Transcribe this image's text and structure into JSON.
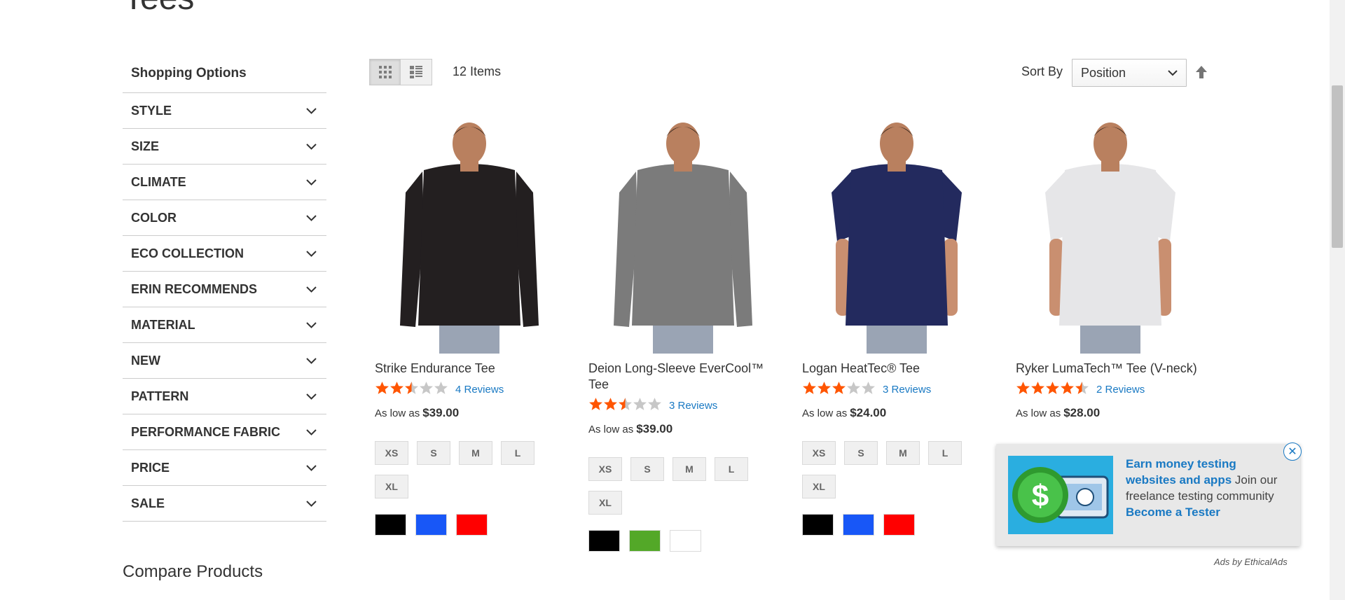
{
  "page": {
    "title": "Tees"
  },
  "sidebar": {
    "title": "Shopping Options",
    "filters": [
      {
        "label": "STYLE"
      },
      {
        "label": "SIZE"
      },
      {
        "label": "CLIMATE"
      },
      {
        "label": "COLOR"
      },
      {
        "label": "ECO COLLECTION"
      },
      {
        "label": "ERIN RECOMMENDS"
      },
      {
        "label": "MATERIAL"
      },
      {
        "label": "NEW"
      },
      {
        "label": "PATTERN"
      },
      {
        "label": "PERFORMANCE FABRIC"
      },
      {
        "label": "PRICE"
      },
      {
        "label": "SALE"
      }
    ],
    "compare_title": "Compare Products"
  },
  "toolbar": {
    "view_modes": [
      {
        "icon": "grid-icon",
        "active": true
      },
      {
        "icon": "list-icon",
        "active": false
      }
    ],
    "items_count": "12 Items",
    "sort_label": "Sort By",
    "sort_value": "Position",
    "sort_direction_icon": "arrow-up-icon"
  },
  "products": [
    {
      "name": "Strike Endurance Tee",
      "rating": 2.5,
      "reviews": "4 Reviews",
      "price_label": "As low as",
      "price": "$39.00",
      "sizes": [
        "XS",
        "S",
        "M",
        "L",
        "XL"
      ],
      "colors": [
        "#000000",
        "#1857f7",
        "#ff0000"
      ],
      "shirt_color": "#231f20",
      "long_sleeve": true
    },
    {
      "name": "Deion Long-Sleeve EverCool™ Tee",
      "rating": 2.5,
      "reviews": "3 Reviews",
      "price_label": "As low as",
      "price": "$39.00",
      "sizes": [
        "XS",
        "S",
        "M",
        "L",
        "XL"
      ],
      "colors": [
        "#000000",
        "#53a828",
        "#ffffff"
      ],
      "shirt_color": "#7b7b7b",
      "long_sleeve": true
    },
    {
      "name": "Logan HeatTec® Tee",
      "rating": 3,
      "reviews": "3 Reviews",
      "price_label": "As low as",
      "price": "$24.00",
      "sizes": [
        "XS",
        "S",
        "M",
        "L",
        "XL"
      ],
      "colors": [
        "#000000",
        "#1857f7",
        "#ff0000"
      ],
      "shirt_color": "#232a5e",
      "long_sleeve": false
    },
    {
      "name": "Ryker LumaTech™ Tee (V-neck)",
      "rating": 4.5,
      "reviews": "2 Reviews",
      "price_label": "As low as",
      "price": "$28.00",
      "sizes": [],
      "colors": [],
      "shirt_color": "#e6e6e8",
      "long_sleeve": false
    }
  ],
  "ad": {
    "headline": "Earn money testing websites and apps",
    "body": " Join our freelance testing community ",
    "cta": "Become a Tester",
    "close_icon": "close-icon",
    "attribution": "Ads by EthicalAds",
    "accent": "#1979c3"
  },
  "colors": {
    "star_on": "#ff5501",
    "star_off": "#c7c7c7",
    "link": "#1979c3"
  }
}
